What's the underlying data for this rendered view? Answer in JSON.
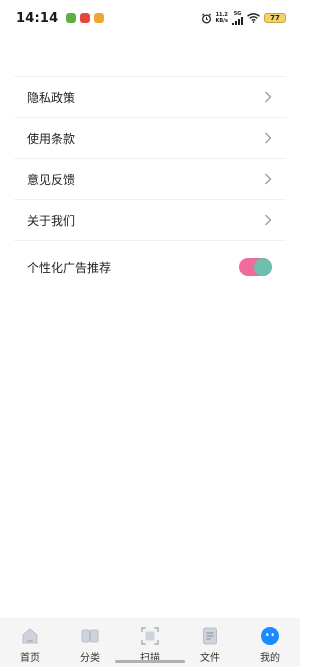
{
  "status_bar": {
    "time": "14:14",
    "net_speed_value": "11.2",
    "net_speed_unit": "KB/s",
    "network_type": "5G",
    "battery": "77"
  },
  "settings": {
    "items": [
      {
        "label": "隐私政策"
      },
      {
        "label": "使用条款"
      },
      {
        "label": "意见反馈"
      },
      {
        "label": "关于我们"
      }
    ],
    "ad_toggle": {
      "label": "个性化广告推荐",
      "enabled": true
    }
  },
  "bottom_nav": {
    "items": [
      {
        "label": "首页",
        "icon": "home-icon"
      },
      {
        "label": "分类",
        "icon": "book-icon"
      },
      {
        "label": "扫描",
        "icon": "scan-icon"
      },
      {
        "label": "文件",
        "icon": "file-icon"
      },
      {
        "label": "我的",
        "icon": "profile-icon",
        "active": true
      }
    ]
  },
  "colors": {
    "toggle_track": "#ef6b9a",
    "toggle_knob": "#6dbfae",
    "active_tab": "#1a8cff",
    "inactive_icon": "#cfd4dc"
  }
}
